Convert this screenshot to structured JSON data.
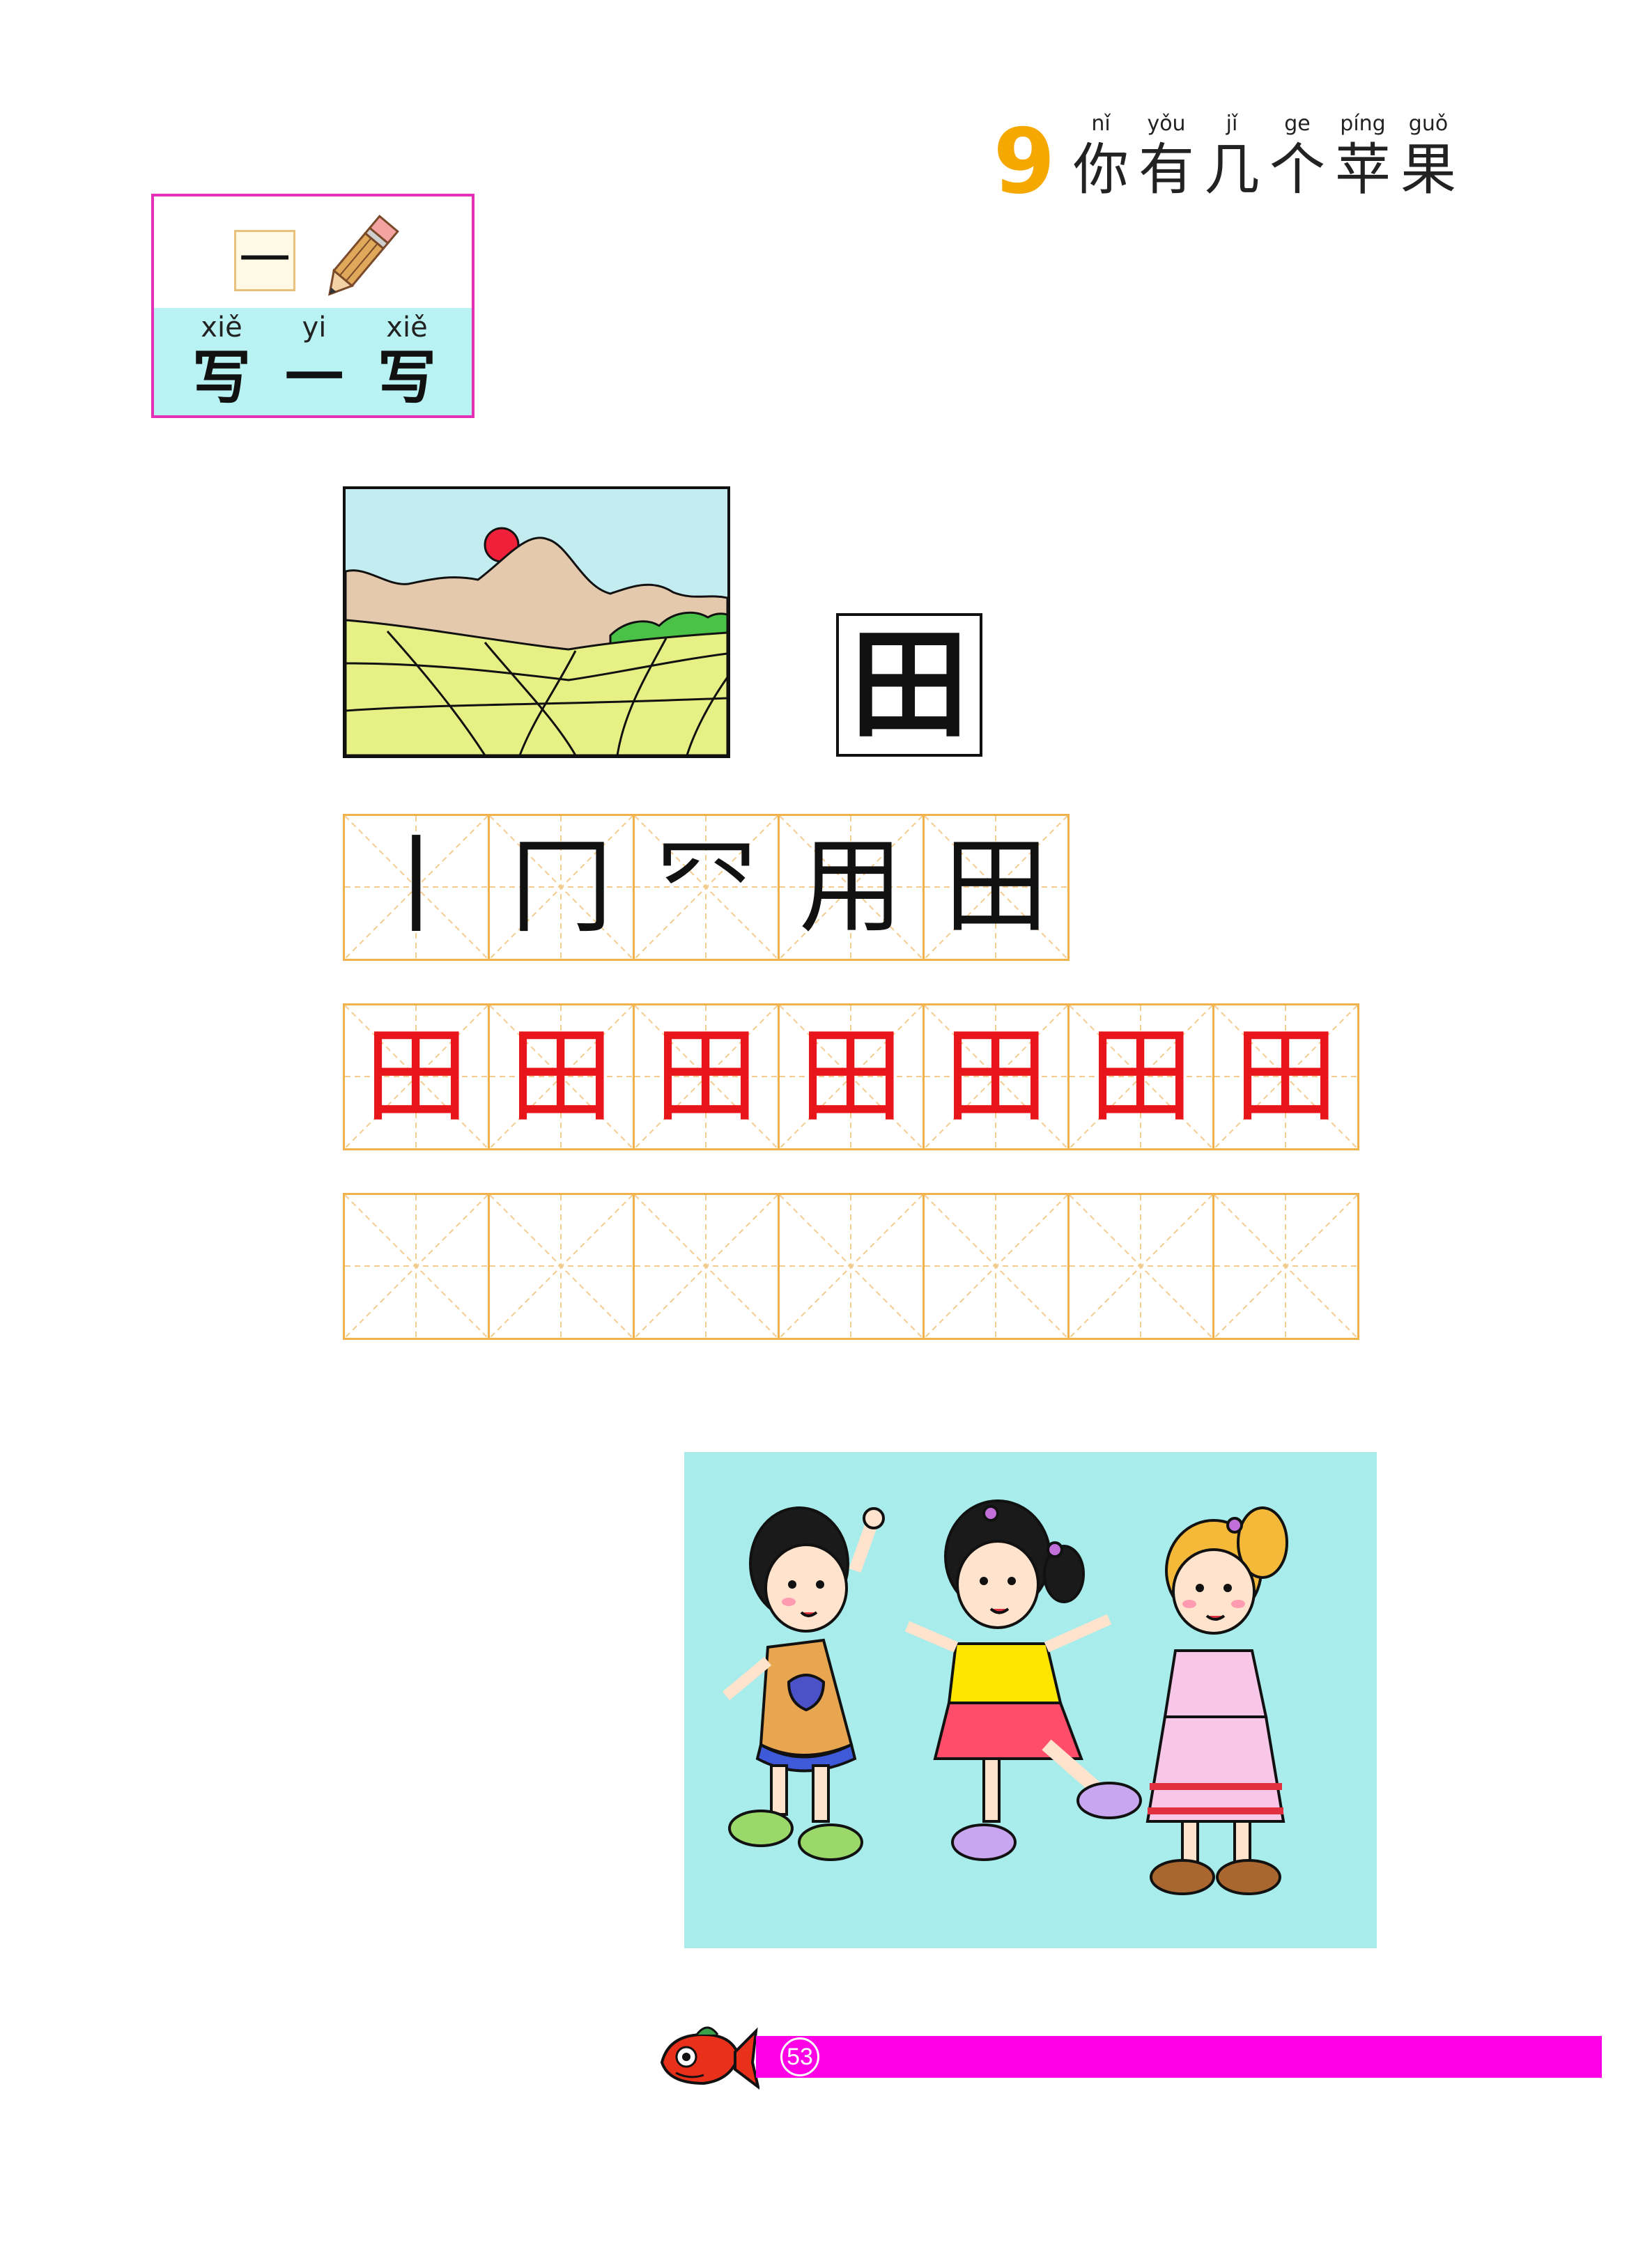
{
  "lesson": {
    "number": "9",
    "title": [
      {
        "pinyin": "nǐ",
        "hanzi": "你"
      },
      {
        "pinyin": "yǒu",
        "hanzi": "有"
      },
      {
        "pinyin": "jǐ",
        "hanzi": "几"
      },
      {
        "pinyin": "ge",
        "hanzi": "个"
      },
      {
        "pinyin": "píng",
        "hanzi": "苹"
      },
      {
        "pinyin": "guǒ",
        "hanzi": "果"
      }
    ]
  },
  "section": {
    "char": "一",
    "label": [
      {
        "pinyin": "xiě",
        "hanzi": "写"
      },
      {
        "pinyin": "yi",
        "hanzi": "一"
      },
      {
        "pinyin": "xiě",
        "hanzi": "写"
      }
    ]
  },
  "target_char": "田",
  "stroke_order": [
    "丨",
    "冂",
    "㓁",
    "用",
    "田"
  ],
  "trace_chars": [
    "田",
    "田",
    "田",
    "田",
    "田",
    "田",
    "田"
  ],
  "practice_blank_count": 7,
  "footer": {
    "page_number": "53"
  },
  "colors": {
    "title_number": "#f5a800",
    "badge_border": "#e42fb7",
    "badge_fill": "#b9f2f2",
    "grid_line": "#f0b24b",
    "trace_red": "#e8161a",
    "footer_bar": "#ff00e6",
    "kids_bg": "#a8ecec"
  }
}
